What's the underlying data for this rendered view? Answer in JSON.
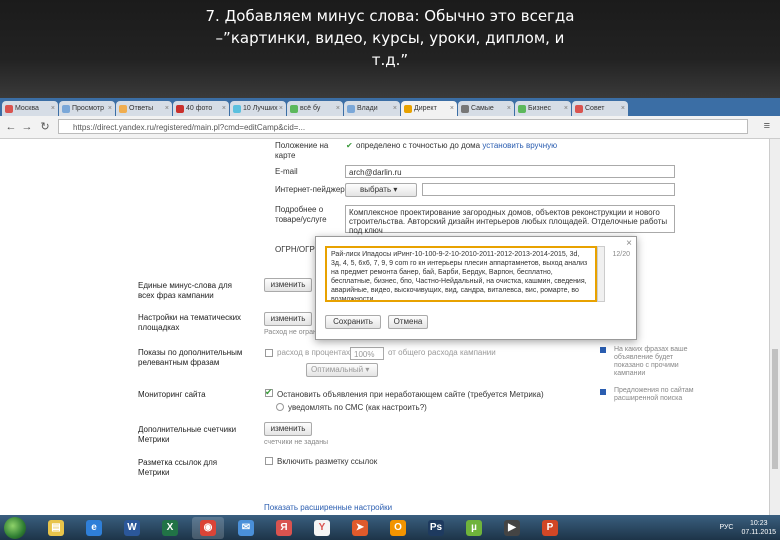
{
  "slide": {
    "title_line1": "7. Добавляем минус слова: Обычно это всегда",
    "title_line2": "–”картинки, видео, курсы, уроки, диплом, и",
    "title_line3": "т.д.”"
  },
  "browser": {
    "tabs": [
      {
        "label": "Москва",
        "color": "#d9534f"
      },
      {
        "label": "Просмотр",
        "color": "#7aa7d8"
      },
      {
        "label": "Ответы",
        "color": "#f0ad4e"
      },
      {
        "label": "40 фото",
        "color": "#c9302c"
      },
      {
        "label": "10 Лучших",
        "color": "#5bc0de"
      },
      {
        "label": "всё бу",
        "color": "#5cb85c"
      },
      {
        "label": "Влади",
        "color": "#7aa7d8"
      },
      {
        "label": "Директ",
        "color": "#e8a200"
      },
      {
        "label": "Самые",
        "color": "#777777"
      },
      {
        "label": "Бизнес",
        "color": "#5cb85c"
      },
      {
        "label": "Совет",
        "color": "#d9534f"
      }
    ],
    "active_tab_index": 7,
    "url": "https://direct.yandex.ru/registered/main.pl?cmd=editCamp&cid=..."
  },
  "form": {
    "geo_checkbox": "Положение на карте",
    "geo_text": "определено с точностью до дома",
    "geo_link": "установить вручную",
    "email_label": "E-mail",
    "email_value": "arch@darlin.ru",
    "messenger_label": "Интернет-пейджер",
    "messenger_select": "выбрать",
    "description_label": "Подробнее о товаре/услуге",
    "description_text": "Комплексное проектирование загородных домов, объектов реконструкции и нового строительства. Авторский дизайн интерьеров любых площадей. Отделочные работы под ключ",
    "ogrn_label": "ОГРН/ОГРНИП",
    "minus_words_label": "Единые минус-слова для всех фраз кампании",
    "minus_words_btn": "изменить",
    "thematic_label": "Настройки на тематических площадках",
    "thematic_btn": "изменить",
    "thematic_sub": "Расход не ограничен",
    "search_label": "Показы по дополнительным релевантным фразам",
    "search_check": "расход в процентах",
    "search_pct": "100%",
    "search_pct_text": "от общего расхода кампании",
    "search_select": "Оптимальный",
    "search_help": "На каких фразах ваше объявление будет показано с прочими кампании",
    "monitor_label": "Мониторинг сайта",
    "monitor_option1": "Остановить объявления при неработающем сайте (требуется Метрика)",
    "monitor_option2": "уведомлять по СМС (как настроить?)",
    "monitor_help": "Предложения по сайтам расширенной поиска",
    "metrika_label": "Дополнительные счетчики Метрики",
    "metrika_btn": "изменить",
    "metrika_sub": "счетчики не заданы",
    "marker_label": "Разметка ссылок для Метрики",
    "marker_check": "Включить разметку ссылок",
    "bottom_link": "Показать расширенные настройки"
  },
  "modal": {
    "text": "Рай-лиск Ипадосы иРинг-10-100-9-2-10-2010-2011-2012-2013-2014-2015, 3d, 3д, 4, 5, 6х6, 7, 9, 9 com го кн интерьеры плесин аппартамнетов, выход анализ на предмет ремонта банер, бай, Барби, Бердук, Варпон, бесплатно, бесплатные, бизнес, бпо, Частно-Нейдальный, на очистка, кашмин, сведения, аварийные, видео, выскочивущих, вид, сандра, виталевса, вис, ромарте, во возможности",
    "counter": "12/20",
    "save_btn": "Сохранить",
    "cancel_btn": "Отмена"
  },
  "taskbar": {
    "apps": [
      {
        "name": "file-explorer-icon",
        "glyph": "▤",
        "color": "#e8c44a"
      },
      {
        "name": "ie-icon",
        "glyph": "e",
        "color": "#2f7fd8"
      },
      {
        "name": "word-icon",
        "glyph": "W",
        "color": "#2b579a"
      },
      {
        "name": "excel-icon",
        "glyph": "X",
        "color": "#217346"
      },
      {
        "name": "chrome-icon",
        "glyph": "◉",
        "color": "#db4437"
      },
      {
        "name": "thunderbird-icon",
        "glyph": "✉",
        "color": "#4a90d9"
      },
      {
        "name": "yandex-icon",
        "glyph": "Я",
        "color": "#d9534f"
      },
      {
        "name": "yandex-browser-icon",
        "glyph": "Y",
        "color": "#f5f5f5"
      },
      {
        "name": "telegram-icon",
        "glyph": "➤",
        "color": "#e05a2b"
      },
      {
        "name": "ok-icon",
        "glyph": "O",
        "color": "#f29400"
      },
      {
        "name": "photoshop-icon",
        "glyph": "Ps",
        "color": "#1e3a5f"
      },
      {
        "name": "torrent-icon",
        "glyph": "µ",
        "color": "#6fb33b"
      },
      {
        "name": "media-icon",
        "glyph": "▶",
        "color": "#444444"
      },
      {
        "name": "powerpoint-icon",
        "glyph": "P",
        "color": "#d24726"
      }
    ],
    "lang": "РУС",
    "time": "10:23",
    "date": "07.11.2015"
  }
}
